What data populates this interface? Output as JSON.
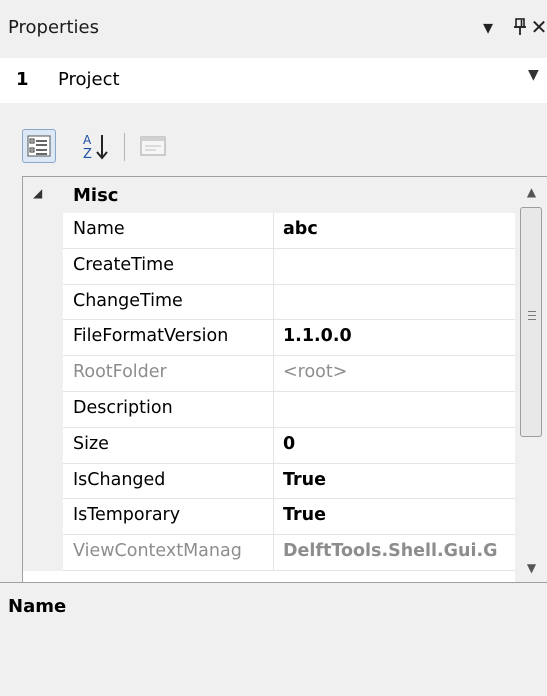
{
  "panel": {
    "title": "Properties",
    "menu_icon": "dropdown-arrow-icon",
    "pin_icon": "pin-icon",
    "close_icon": "close-icon"
  },
  "selector": {
    "number": "1",
    "value": "Project"
  },
  "toolbar": {
    "buttons": [
      {
        "icon": "categorized-view-icon",
        "active": true
      },
      {
        "icon": "sort-alphabetical-icon",
        "active": false
      },
      {
        "icon": "property-pages-icon",
        "active": false,
        "disabled": true
      }
    ]
  },
  "grid": {
    "category": "Misc",
    "rows": [
      {
        "name": "Name",
        "value": "abc",
        "readonly": false
      },
      {
        "name": "CreateTime",
        "value": "",
        "readonly": false
      },
      {
        "name": "ChangeTime",
        "value": "",
        "readonly": false
      },
      {
        "name": "FileFormatVersion",
        "value": "1.1.0.0",
        "readonly": false
      },
      {
        "name": "RootFolder",
        "value": "<root>",
        "readonly": true
      },
      {
        "name": "Description",
        "value": "",
        "readonly": false
      },
      {
        "name": "Size",
        "value": "0",
        "readonly": false
      },
      {
        "name": "IsChanged",
        "value": "True",
        "readonly": false
      },
      {
        "name": "IsTemporary",
        "value": "True",
        "readonly": false
      },
      {
        "name": "ViewContextManag",
        "value": "DelftTools.Shell.Gui.G",
        "readonly": true
      }
    ]
  },
  "description": {
    "title": "Name"
  }
}
